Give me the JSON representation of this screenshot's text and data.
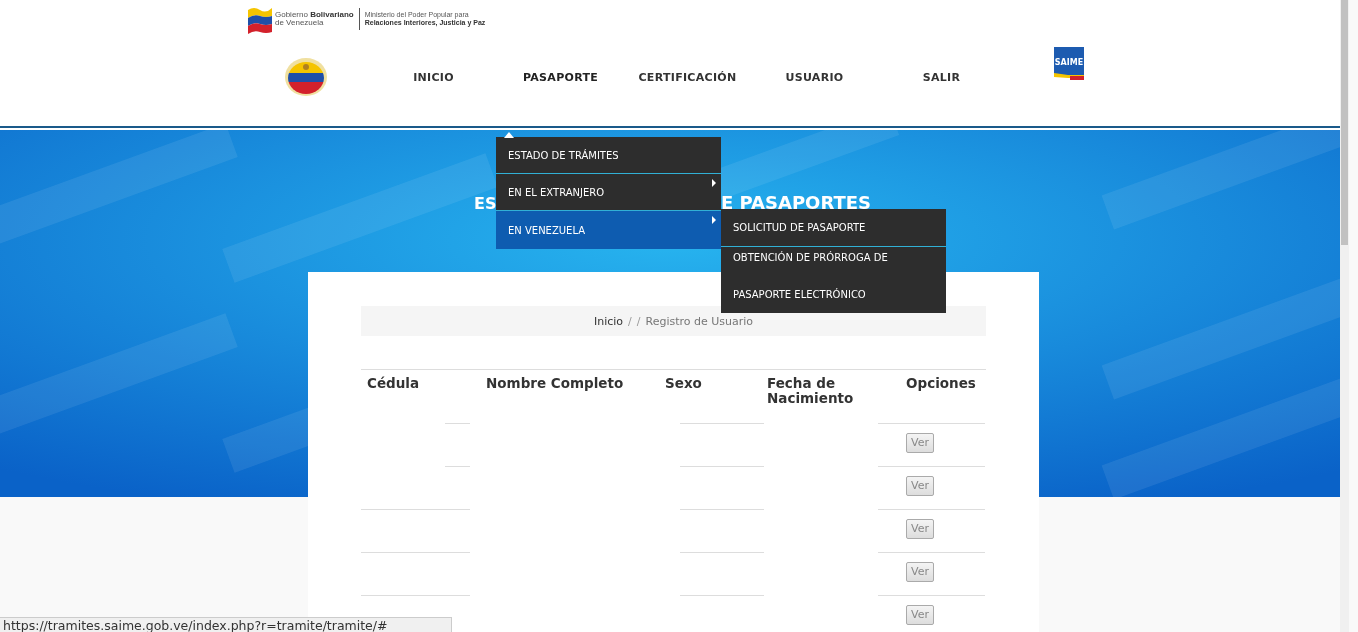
{
  "header": {
    "gov_logo": {
      "title_prefix": "Gobierno ",
      "title_bold": "Bolivariano",
      "subtitle": "de Venezuela",
      "ministry_line_1": "Ministerio del Poder Popular para",
      "ministry_line_2": "Relaciones Interiores, Justicia y Paz"
    },
    "agency_logo": {
      "text": "SAIME"
    }
  },
  "nav": [
    {
      "label": "INICIO",
      "open": false
    },
    {
      "label": "PASAPORTE",
      "open": true
    },
    {
      "label": "CERTIFICACIÓN",
      "open": false
    },
    {
      "label": "USUARIO",
      "open": false
    },
    {
      "label": "SALIR",
      "open": false
    }
  ],
  "dropdown": [
    {
      "label": "ESTADO DE TRÁMITES",
      "selected": false,
      "has_submenu": false
    },
    {
      "label": "EN EL EXTRANJERO",
      "selected": false,
      "has_submenu": true
    },
    {
      "label": "EN VENEZUELA",
      "selected": true,
      "has_submenu": true,
      "children": [
        {
          "label": "SOLICITUD DE PASAPORTE",
          "selected": false
        },
        {
          "label": "OBTENCIÓN DE PRÓRROGA DE PASAPORTE ELECTRÓNICO",
          "selected": false
        }
      ]
    }
  ],
  "banner": {
    "heading_parts": [
      "ES",
      "E PASAPORTES"
    ]
  },
  "breadcrumb": [
    {
      "label": "Inicio",
      "kind": "link"
    },
    {
      "label": "/",
      "kind": "separator"
    },
    {
      "label": "/",
      "kind": "separator"
    },
    {
      "label": "Registro de Usuario",
      "kind": "current"
    }
  ],
  "table": {
    "columns": [
      "Cédula",
      "Nombre Completo",
      "Sexo",
      "Fecha de Nacimiento",
      "Opciones"
    ],
    "rows": [
      {
        "action": "Ver"
      },
      {
        "action": "Ver"
      },
      {
        "action": "Ver"
      },
      {
        "action": "Ver"
      },
      {
        "action": "Ver"
      }
    ]
  },
  "status_bar": {
    "url": "https://tramites.saime.gob.ve/index.php?r=tramite/tramite/#"
  }
}
